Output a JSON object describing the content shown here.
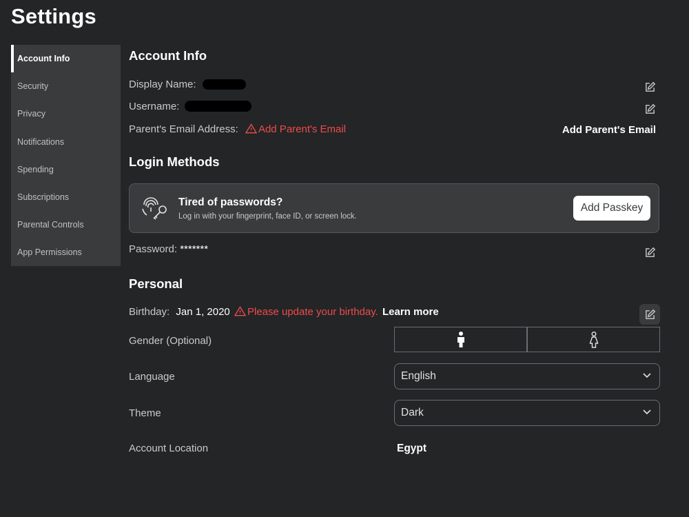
{
  "page": {
    "title": "Settings"
  },
  "sidebar": {
    "items": [
      {
        "label": "Account Info"
      },
      {
        "label": "Security"
      },
      {
        "label": "Privacy"
      },
      {
        "label": "Notifications"
      },
      {
        "label": "Spending"
      },
      {
        "label": "Subscriptions"
      },
      {
        "label": "Parental Controls"
      },
      {
        "label": "App Permissions"
      }
    ]
  },
  "account_info": {
    "title": "Account Info",
    "display_name_label": "Display Name:",
    "username_label": "Username:",
    "parent_email_label": "Parent's Email Address:",
    "parent_email_warning": "Add Parent's Email",
    "parent_email_action": "Add Parent's Email"
  },
  "login_methods": {
    "title": "Login Methods",
    "passkey_title": "Tired of passwords?",
    "passkey_subtitle": "Log in with your fingerprint, face ID, or screen lock.",
    "passkey_button": "Add Passkey",
    "password_label": "Password:",
    "password_value": "*******"
  },
  "personal": {
    "title": "Personal",
    "birthday_label": "Birthday:",
    "birthday_value": "Jan 1, 2020",
    "birthday_warning": "Please update your birthday.",
    "birthday_learn_more": "Learn more",
    "gender_label": "Gender (Optional)",
    "language_label": "Language",
    "language_value": "English",
    "theme_label": "Theme",
    "theme_value": "Dark",
    "location_label": "Account Location",
    "location_value": "Egypt"
  },
  "colors": {
    "background": "#232527",
    "panel": "#393b3d",
    "warning": "#ef4b4b",
    "text": "#c8cacc"
  },
  "icons": [
    "edit-icon",
    "warning-icon",
    "fingerprint-key-icon",
    "male-icon",
    "female-icon",
    "chevron-down-icon"
  ]
}
